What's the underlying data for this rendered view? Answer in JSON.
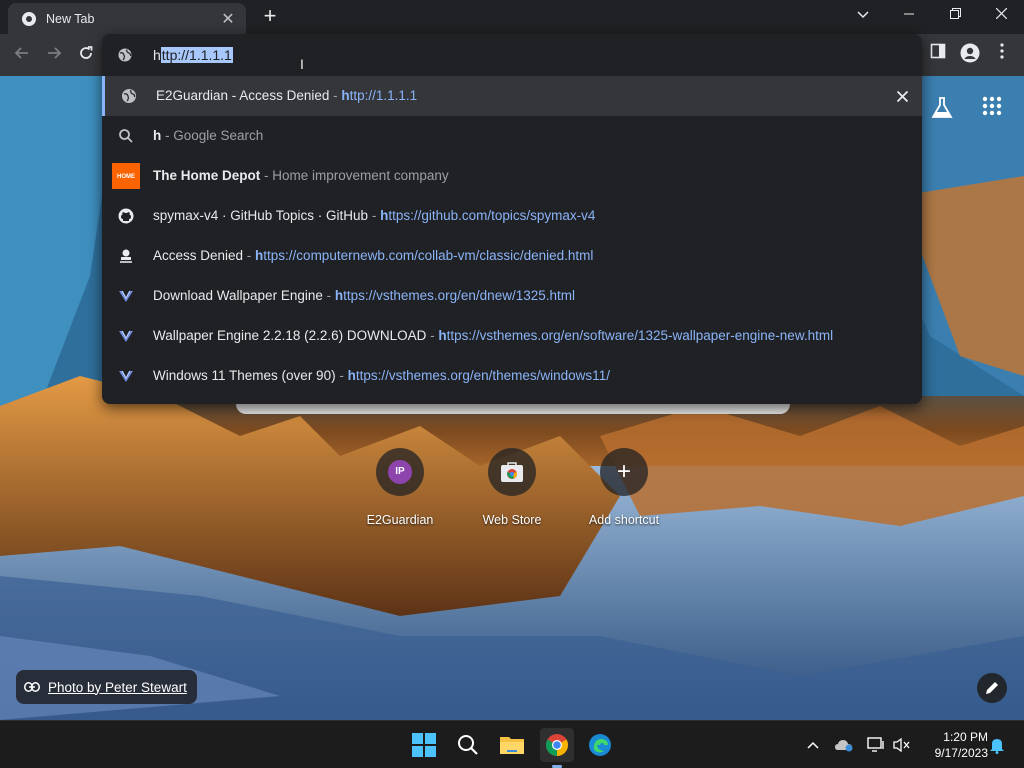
{
  "tab": {
    "title": "New Tab",
    "close": "✕",
    "new_tab": "+"
  },
  "window_controls": {
    "minimize": "—",
    "restore": "❐",
    "close": "✕",
    "tab_search": "⌄"
  },
  "omnibox": {
    "typed_char": "h",
    "selected_text": "ttp://1.1.1.1",
    "suggestions": [
      {
        "title": "E2Guardian - Access Denied",
        "sep": " - ",
        "url_bold": "h",
        "url": "ttp://1.1.1.1",
        "icon": "globe-icon",
        "active": true
      },
      {
        "title_bold": "h",
        "title": "",
        "sep": " - ",
        "desc": "Google Search",
        "icon": "search-icon"
      },
      {
        "title_pre": "The ",
        "title_bold": "H",
        "title": "ome Depot",
        "sep": " - ",
        "desc": "Home improvement company",
        "icon": "home-depot-icon"
      },
      {
        "title": "spymax-v4 · GitHub Topics · GitHub",
        "sep": " - ",
        "url_bold": "h",
        "url": "ttps://github.com/topics/spymax-v4",
        "icon": "github-icon"
      },
      {
        "title": "Access Denied",
        "sep": " - ",
        "url_bold": "h",
        "url": "ttps://computernewb.com/collab-vm/classic/denied.html",
        "icon": "collab-vm-icon"
      },
      {
        "title": "Download Wallpaper Engine",
        "sep": " - ",
        "url_bold": "h",
        "url": "ttps://vsthemes.org/en/dnew/1325.html",
        "icon": "vsthemes-icon"
      },
      {
        "title": "Wallpaper Engine 2.2.18 (2.2.6) DOWNLOAD",
        "sep": " - ",
        "url_bold": "h",
        "url": "ttps://vsthemes.org/en/software/1325-wallpaper-engine-new.html",
        "icon": "vsthemes-icon"
      },
      {
        "title": "Windows 11 Themes (over 90)",
        "sep": " - ",
        "url_bold": "h",
        "url": "ttps://vsthemes.org/en/themes/windows11/",
        "icon": "vsthemes-icon"
      }
    ]
  },
  "shortcuts": [
    {
      "label": "E2Guardian",
      "badge": "IP"
    },
    {
      "label": "Web Store"
    },
    {
      "label": "Add shortcut",
      "glyph": "+"
    }
  ],
  "credit": {
    "text": "Photo by Peter Stewart"
  },
  "clock": {
    "time": "1:20 PM",
    "date": "9/17/2023"
  },
  "colors": {
    "accent": "#8ab4f8",
    "popup_bg": "#202124",
    "selection": "#a8c7fa"
  }
}
